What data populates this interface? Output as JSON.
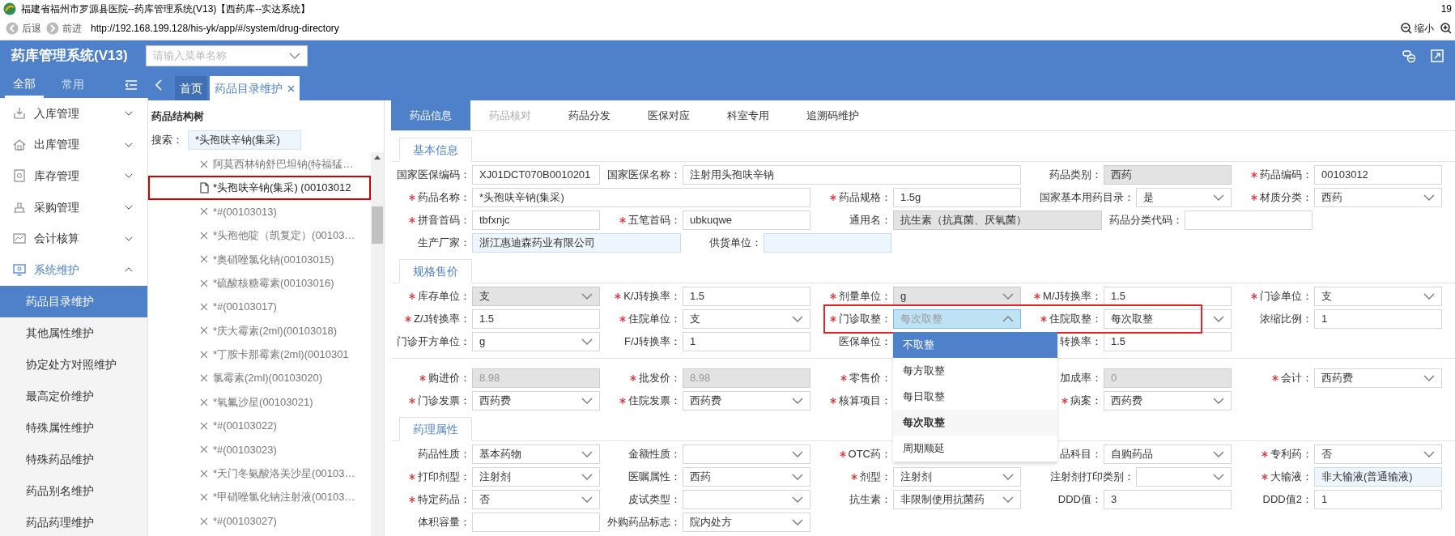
{
  "window": {
    "title": "福建省福州市罗源县医院--药库管理系统(V13)【西药库--实达系统】",
    "clock": "19"
  },
  "browser": {
    "back": "后退",
    "forward": "前进",
    "url": "http://192.168.199.128/his-yk/app/#/system/drug-directory",
    "zoom_out": "缩小"
  },
  "header": {
    "app_title": "药库管理系统(V13)",
    "menu_search": {
      "placeholder": "请输入菜单名称"
    }
  },
  "sidebar": {
    "tabs": [
      {
        "label": "全部",
        "selected": true
      },
      {
        "label": "常用",
        "selected": false
      }
    ],
    "groups": [
      {
        "label": "入库管理",
        "expanded": false
      },
      {
        "label": "出库管理",
        "expanded": false
      },
      {
        "label": "库存管理",
        "expanded": false
      },
      {
        "label": "采购管理",
        "expanded": false
      },
      {
        "label": "会计核算",
        "expanded": false
      },
      {
        "label": "系统维护",
        "expanded": true,
        "children": [
          {
            "label": "药品目录维护",
            "selected": true
          },
          {
            "label": "其他属性维护",
            "selected": false
          },
          {
            "label": "协定处方对照维护",
            "selected": false
          },
          {
            "label": "最高定价维护",
            "selected": false
          },
          {
            "label": "特殊属性维护",
            "selected": false
          },
          {
            "label": "特殊药品维护",
            "selected": false
          },
          {
            "label": "药品别名维护",
            "selected": false
          },
          {
            "label": "药品药理维护",
            "selected": false
          }
        ]
      }
    ]
  },
  "page_tabs": [
    {
      "label": "首页",
      "selected": false,
      "closable": false
    },
    {
      "label": "药品目录维护",
      "selected": true,
      "closable": true
    }
  ],
  "tree": {
    "title": "药品结构树",
    "search_label": "搜索：",
    "search_value": "*头孢呋辛钠(集采)",
    "items": [
      {
        "text": "阿莫西林钠舒巴坦钠(特福猛…",
        "stopped": true,
        "selected": false
      },
      {
        "text": "*头孢呋辛钠(集采) (00103012",
        "stopped": false,
        "selected": true
      },
      {
        "text": "*#(00103013)",
        "stopped": true,
        "selected": false
      },
      {
        "text": "*头孢他啶（凯复定）(00103…",
        "stopped": true,
        "selected": false
      },
      {
        "text": "*奥硝唑氯化钠(00103015)",
        "stopped": true,
        "selected": false
      },
      {
        "text": "*硫酸核糖霉素(00103016)",
        "stopped": true,
        "selected": false
      },
      {
        "text": "*#(00103017)",
        "stopped": true,
        "selected": false
      },
      {
        "text": "*庆大霉素(2ml)(00103018)",
        "stopped": true,
        "selected": false
      },
      {
        "text": "*丁胺卡那霉素(2ml)(0010301",
        "stopped": true,
        "selected": false
      },
      {
        "text": "氯霉素(2ml)(00103020)",
        "stopped": true,
        "selected": false
      },
      {
        "text": "*氧氟沙星(00103021)",
        "stopped": true,
        "selected": false
      },
      {
        "text": "*#(00103022)",
        "stopped": true,
        "selected": false
      },
      {
        "text": "*#(00103023)",
        "stopped": true,
        "selected": false
      },
      {
        "text": "*天门冬氨酸洛美沙星(00103…",
        "stopped": true,
        "selected": false
      },
      {
        "text": "*甲硝唑氯化钠注射液(00103…",
        "stopped": true,
        "selected": false
      },
      {
        "text": "*#(00103027)",
        "stopped": true,
        "selected": false
      }
    ]
  },
  "detail_tabs": [
    {
      "label": "药品信息",
      "selected": true,
      "disabled": false
    },
    {
      "label": "药品核对",
      "selected": false,
      "disabled": true
    },
    {
      "label": "药品分发",
      "selected": false,
      "disabled": false
    },
    {
      "label": "医保对应",
      "selected": false,
      "disabled": false
    },
    {
      "label": "科室专用",
      "selected": false,
      "disabled": false
    },
    {
      "label": "追溯码维护",
      "selected": false,
      "disabled": false
    }
  ],
  "sections": [
    {
      "title": "基本信息",
      "groups": [
        [
          [
            {
              "label": "国家医保编码：",
              "required": false,
              "kind": "input",
              "readonly": false,
              "disabled": false,
              "value": "XJ01DCT070B0010201"
            },
            {
              "label": "国家医保名称：",
              "required": false,
              "kind": "input",
              "readonly": false,
              "disabled": false,
              "value": "注射用头孢呋辛钠"
            },
            {
              "label": "药品类别：",
              "required": false,
              "kind": "input",
              "readonly": true,
              "disabled": false,
              "value": "西药"
            },
            {
              "label": "药品编码：",
              "required": true,
              "kind": "input",
              "readonly": false,
              "disabled": false,
              "value": "00103012"
            }
          ],
          [
            {
              "label": "药品名称：",
              "required": true,
              "kind": "input",
              "readonly": false,
              "disabled": false,
              "value": "*头孢呋辛钠(集采)"
            },
            {
              "label": "药品规格：",
              "required": true,
              "kind": "input",
              "readonly": false,
              "disabled": false,
              "value": "1.5g"
            },
            {
              "label": "国家基本用药目录：",
              "required": false,
              "kind": "select",
              "readonly": false,
              "disabled": false,
              "expanded": false,
              "value": "是"
            },
            {
              "label": "材质分类：",
              "required": true,
              "kind": "select",
              "readonly": false,
              "disabled": false,
              "expanded": false,
              "value": "西药"
            }
          ],
          [
            {
              "label": "拼音首码：",
              "required": true,
              "kind": "input",
              "readonly": false,
              "disabled": false,
              "value": "tbfxnjc"
            },
            {
              "label": "五笔首码：",
              "required": true,
              "kind": "input",
              "readonly": false,
              "disabled": false,
              "value": "ubkuqwe"
            },
            {
              "label": "通用名：",
              "required": false,
              "kind": "input",
              "readonly": true,
              "disabled": false,
              "value": "抗生素（抗真菌、厌氧菌）"
            },
            {
              "label": "药品分类代码：",
              "required": false,
              "kind": "input",
              "readonly": false,
              "disabled": false
            }
          ],
          [
            {
              "label": "生产厂家：",
              "required": false,
              "kind": "lookup",
              "readonly": false,
              "disabled": false,
              "value": "浙江惠迪森药业有限公司"
            },
            {
              "label": "供货单位：",
              "required": false,
              "kind": "lookup",
              "readonly": false,
              "disabled": false
            }
          ]
        ]
      ]
    },
    {
      "title": "规格售价",
      "groups": [
        [
          [
            {
              "label": "库存单位：",
              "required": true,
              "kind": "select",
              "readonly": true,
              "disabled": false,
              "expanded": false,
              "value": "支"
            },
            {
              "label": "K/J转换率：",
              "required": true,
              "kind": "input",
              "readonly": false,
              "disabled": false,
              "value": "1.5"
            },
            {
              "label": "剂量单位：",
              "required": true,
              "kind": "select",
              "readonly": true,
              "disabled": false,
              "expanded": false,
              "value": "g"
            },
            {
              "label": "M/J转换率：",
              "required": true,
              "kind": "input",
              "readonly": false,
              "disabled": false,
              "value": "1.5"
            },
            {
              "label": "门诊单位：",
              "required": true,
              "kind": "select",
              "readonly": false,
              "disabled": false,
              "expanded": false,
              "value": "支"
            }
          ],
          [
            {
              "label": "Z/J转换率：",
              "required": true,
              "kind": "input",
              "readonly": false,
              "disabled": false,
              "value": "1.5"
            },
            {
              "label": "住院单位：",
              "required": true,
              "kind": "select",
              "readonly": false,
              "disabled": false,
              "expanded": false,
              "value": "支"
            },
            {
              "label": "门诊取整：",
              "required": true,
              "kind": "select",
              "expanded": true,
              "value": "每次取整",
              "options": [
                {
                  "text": "不取整",
                  "highlighted": true,
                  "selected": false
                },
                {
                  "text": "每方取整",
                  "highlighted": false,
                  "selected": false
                },
                {
                  "text": "每日取整",
                  "highlighted": false,
                  "selected": false
                },
                {
                  "text": "每次取整",
                  "highlighted": false,
                  "selected": true
                },
                {
                  "text": "周期顺延",
                  "highlighted": false,
                  "selected": false
                }
              ]
            },
            {
              "label": "住院取整：",
              "required": true,
              "kind": "select",
              "readonly": false,
              "disabled": false,
              "expanded": false,
              "value": "每次取整"
            },
            {
              "label": "浓缩比例：",
              "required": false,
              "kind": "input",
              "readonly": false,
              "disabled": false,
              "value": "1"
            }
          ],
          [
            {
              "label": "门诊开方单位：",
              "required": false,
              "kind": "select",
              "readonly": false,
              "disabled": false,
              "expanded": false,
              "value": "g"
            },
            {
              "label": "F/J转换率：",
              "required": false,
              "kind": "input",
              "readonly": false,
              "disabled": false,
              "value": "1"
            },
            {
              "label": "医保单位：",
              "required": false,
              "kind": "covered"
            },
            {
              "label": "转换率：",
              "kind": "input",
              "readonly": false,
              "disabled": false,
              "value": "1.5"
            }
          ]
        ],
        [
          [
            {
              "label": "购进价：",
              "required": true,
              "kind": "input",
              "readonly": false,
              "disabled": true,
              "value": "8.98"
            },
            {
              "label": "批发价：",
              "required": true,
              "kind": "input",
              "readonly": false,
              "disabled": true,
              "value": "8.98"
            },
            {
              "label": "零售价：",
              "required": true,
              "kind": "covered"
            },
            {
              "label": "加成率：",
              "required": false,
              "kind": "input",
              "readonly": false,
              "disabled": true,
              "value": "0"
            },
            {
              "label": "会计：",
              "required": true,
              "kind": "select",
              "readonly": false,
              "disabled": false,
              "expanded": false,
              "value": "西药费"
            }
          ],
          [
            {
              "label": "门诊发票：",
              "required": true,
              "kind": "select",
              "readonly": false,
              "disabled": false,
              "expanded": false,
              "value": "西药费"
            },
            {
              "label": "住院发票：",
              "required": true,
              "kind": "select",
              "readonly": false,
              "disabled": false,
              "expanded": false,
              "value": "西药费"
            },
            {
              "label": "核算项目：",
              "required": true,
              "kind": "covered"
            },
            {
              "label": "病案：",
              "required": true,
              "kind": "select",
              "readonly": false,
              "disabled": false,
              "expanded": false,
              "value": "西药费"
            }
          ]
        ]
      ]
    },
    {
      "title": "药理属性",
      "groups": [
        [
          [
            {
              "label": "药品性质：",
              "required": false,
              "kind": "select",
              "readonly": false,
              "disabled": false,
              "expanded": false,
              "value": "基本药物"
            },
            {
              "label": "金额性质：",
              "required": false,
              "kind": "select",
              "readonly": false,
              "disabled": false,
              "expanded": false
            },
            {
              "label": "OTC药：",
              "required": true,
              "kind": "covered"
            },
            {
              "label": "品科目：",
              "kind": "select",
              "readonly": false,
              "disabled": false,
              "expanded": false,
              "value": "自购药品"
            },
            {
              "label": "专利药：",
              "required": true,
              "kind": "select",
              "readonly": false,
              "disabled": false,
              "expanded": false,
              "value": "否"
            }
          ],
          [
            {
              "label": "打印剂型：",
              "required": true,
              "kind": "select",
              "readonly": false,
              "disabled": false,
              "expanded": false,
              "value": "注射剂"
            },
            {
              "label": "医嘱属性：",
              "required": false,
              "kind": "select",
              "readonly": false,
              "disabled": false,
              "expanded": false,
              "value": "西药"
            },
            {
              "label": "剂型：",
              "required": true,
              "kind": "select",
              "readonly": false,
              "disabled": false,
              "expanded": false,
              "value": "注射剂"
            },
            {
              "label": "注射剂打印类别：",
              "required": false,
              "kind": "select",
              "readonly": false,
              "disabled": false,
              "expanded": false
            },
            {
              "label": "大输液：",
              "required": true,
              "kind": "lookup",
              "readonly": false,
              "disabled": false,
              "value": "非大输液(普通输液)"
            }
          ],
          [
            {
              "label": "特定药品：",
              "required": true,
              "kind": "select",
              "readonly": false,
              "disabled": false,
              "expanded": false,
              "value": "否"
            },
            {
              "label": "皮试类型：",
              "required": false,
              "kind": "select",
              "readonly": false,
              "disabled": false,
              "expanded": false
            },
            {
              "label": "抗生素：",
              "required": false,
              "kind": "select",
              "readonly": false,
              "disabled": false,
              "expanded": false,
              "value": "非限制使用抗菌药"
            },
            {
              "label": "DDD值：",
              "required": false,
              "kind": "input",
              "readonly": false,
              "disabled": false,
              "value": "3"
            },
            {
              "label": "DDD值2：",
              "required": false,
              "kind": "input",
              "readonly": false,
              "disabled": false,
              "value": "1"
            }
          ],
          [
            {
              "label": "体积容量：",
              "required": false,
              "kind": "input",
              "readonly": false,
              "disabled": false
            },
            {
              "label": "外购药品标志：",
              "required": false,
              "kind": "select",
              "readonly": false,
              "disabled": false,
              "expanded": false,
              "value": "院内处方"
            }
          ]
        ]
      ]
    }
  ]
}
